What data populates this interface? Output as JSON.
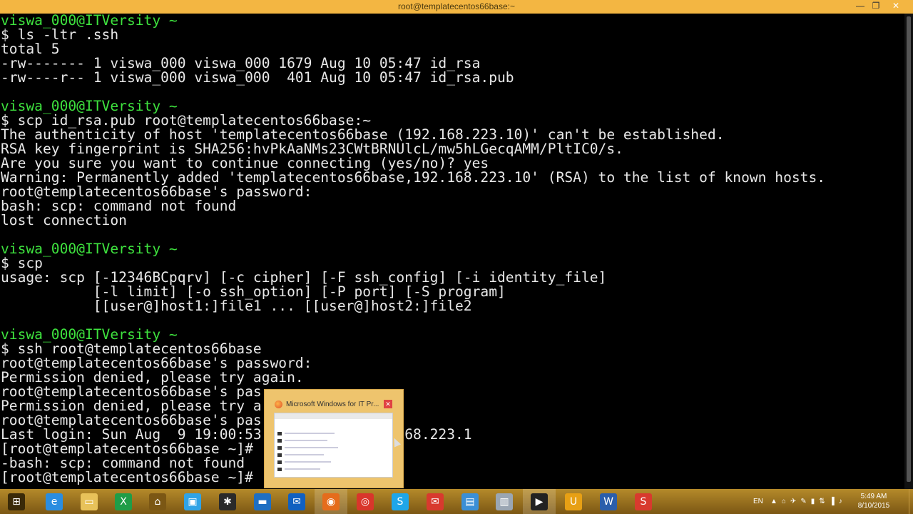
{
  "window": {
    "title": "root@templatecentos66base:~",
    "minimize_glyph": "—",
    "maximize_glyph": "❐",
    "close_glyph": "✕"
  },
  "terminal": {
    "lines": [
      {
        "text": "viswa_000@ITVersity ~",
        "kind": "prompt"
      },
      {
        "text": "$ ls -ltr .ssh",
        "kind": "normal"
      },
      {
        "text": "total 5",
        "kind": "normal"
      },
      {
        "text": "-rw------- 1 viswa_000 viswa_000 1679 Aug 10 05:47 id_rsa",
        "kind": "normal"
      },
      {
        "text": "-rw----r-- 1 viswa_000 viswa_000  401 Aug 10 05:47 id_rsa.pub",
        "kind": "normal"
      },
      {
        "text": "",
        "kind": "normal"
      },
      {
        "text": "viswa_000@ITVersity ~",
        "kind": "prompt"
      },
      {
        "text": "$ scp id_rsa.pub root@templatecentos66base:~",
        "kind": "normal"
      },
      {
        "text": "The authenticity of host 'templatecentos66base (192.168.223.10)' can't be established.",
        "kind": "normal"
      },
      {
        "text": "RSA key fingerprint is SHA256:hvPkAaNMs23CWtBRNUlcL/mw5hLGecqAMM/PltIC0/s.",
        "kind": "normal"
      },
      {
        "text": "Are you sure you want to continue connecting (yes/no)? yes",
        "kind": "normal"
      },
      {
        "text": "Warning: Permanently added 'templatecentos66base,192.168.223.10' (RSA) to the list of known hosts.",
        "kind": "normal"
      },
      {
        "text": "root@templatecentos66base's password:",
        "kind": "normal"
      },
      {
        "text": "bash: scp: command not found",
        "kind": "normal"
      },
      {
        "text": "lost connection",
        "kind": "normal"
      },
      {
        "text": "",
        "kind": "normal"
      },
      {
        "text": "viswa_000@ITVersity ~",
        "kind": "prompt"
      },
      {
        "text": "$ scp",
        "kind": "normal"
      },
      {
        "text": "usage: scp [-12346BCpqrv] [-c cipher] [-F ssh_config] [-i identity_file]",
        "kind": "normal"
      },
      {
        "text": "           [-l limit] [-o ssh_option] [-P port] [-S program]",
        "kind": "normal"
      },
      {
        "text": "           [[user@]host1:]file1 ... [[user@]host2:]file2",
        "kind": "normal"
      },
      {
        "text": "",
        "kind": "normal"
      },
      {
        "text": "viswa_000@ITVersity ~",
        "kind": "prompt"
      },
      {
        "text": "$ ssh root@templatecentos66base",
        "kind": "normal"
      },
      {
        "text": "root@templatecentos66base's password:",
        "kind": "normal"
      },
      {
        "text": "Permission denied, please try again.",
        "kind": "normal"
      },
      {
        "text": "root@templatecentos66base's pas",
        "kind": "normal"
      },
      {
        "text": "Permission denied, please try a",
        "kind": "normal"
      },
      {
        "text": "root@templatecentos66base's pas",
        "kind": "normal"
      },
      {
        "text": "Last login: Sun Aug  9 19:00:53                 68.223.1",
        "kind": "normal"
      },
      {
        "text": "[root@templatecentos66base ~]#",
        "kind": "normal"
      },
      {
        "text": "-bash: scp: command not found",
        "kind": "normal"
      },
      {
        "text": "[root@templatecentos66base ~]#",
        "kind": "normal"
      }
    ]
  },
  "preview": {
    "title": "Microsoft Windows for IT Pr...",
    "close_glyph": "✕"
  },
  "taskbar": {
    "items": [
      {
        "name": "start-button",
        "icon": "windows-logo-icon",
        "glyph": "⊞",
        "color": "#3a2a08"
      },
      {
        "name": "internet-explorer-button",
        "icon": "internet-explorer-icon",
        "glyph": "e",
        "color": "#2a8de0"
      },
      {
        "name": "file-explorer-button",
        "icon": "folder-icon",
        "glyph": "▭",
        "color": "#e8c25a"
      },
      {
        "name": "excel-button",
        "icon": "spreadsheet-icon",
        "glyph": "X",
        "color": "#1f9d48"
      },
      {
        "name": "home-button",
        "icon": "home-icon",
        "glyph": "⌂",
        "color": "#7b5714"
      },
      {
        "name": "store-button",
        "icon": "store-icon",
        "glyph": "▣",
        "color": "#2fa3e6"
      },
      {
        "name": "app-network-button",
        "icon": "network-graph-icon",
        "glyph": "✱",
        "color": "#2a2a2a"
      },
      {
        "name": "remote-desktop-button",
        "icon": "monitor-icon",
        "glyph": "▬",
        "color": "#1e6fc2"
      },
      {
        "name": "outlook-button",
        "icon": "mail-app-icon",
        "glyph": "✉",
        "color": "#1060c0"
      },
      {
        "name": "firefox-button",
        "icon": "firefox-icon",
        "glyph": "◉",
        "color": "#e56c1c"
      },
      {
        "name": "chrome-button",
        "icon": "chrome-icon",
        "glyph": "◎",
        "color": "#d9362b"
      },
      {
        "name": "skype-button",
        "icon": "skype-icon",
        "glyph": "S",
        "color": "#1fa6e8"
      },
      {
        "name": "mail-button",
        "icon": "mail-icon",
        "glyph": "✉",
        "color": "#d83a2e"
      },
      {
        "name": "word-pad-button",
        "icon": "document-icon",
        "glyph": "▤",
        "color": "#3b8fd6"
      },
      {
        "name": "file-manager-button",
        "icon": "folder-files-icon",
        "glyph": "▥",
        "color": "#9aa6b3"
      },
      {
        "name": "terminal-button",
        "icon": "terminal-icon",
        "glyph": "▶",
        "color": "#222"
      },
      {
        "name": "ultraedit-button",
        "icon": "editor-icon",
        "glyph": "U",
        "color": "#e7a014"
      },
      {
        "name": "word-button",
        "icon": "word-icon",
        "glyph": "W",
        "color": "#2b5eab"
      },
      {
        "name": "screen-recorder-button",
        "icon": "recorder-icon",
        "glyph": "S",
        "color": "#d83a2e"
      }
    ],
    "language": "EN",
    "tray_icons": [
      "▲",
      "⌂",
      "✈",
      "✎",
      "▮",
      "⇅",
      "▐",
      "♪"
    ],
    "time": "5:49 AM",
    "date": "8/10/2015"
  }
}
